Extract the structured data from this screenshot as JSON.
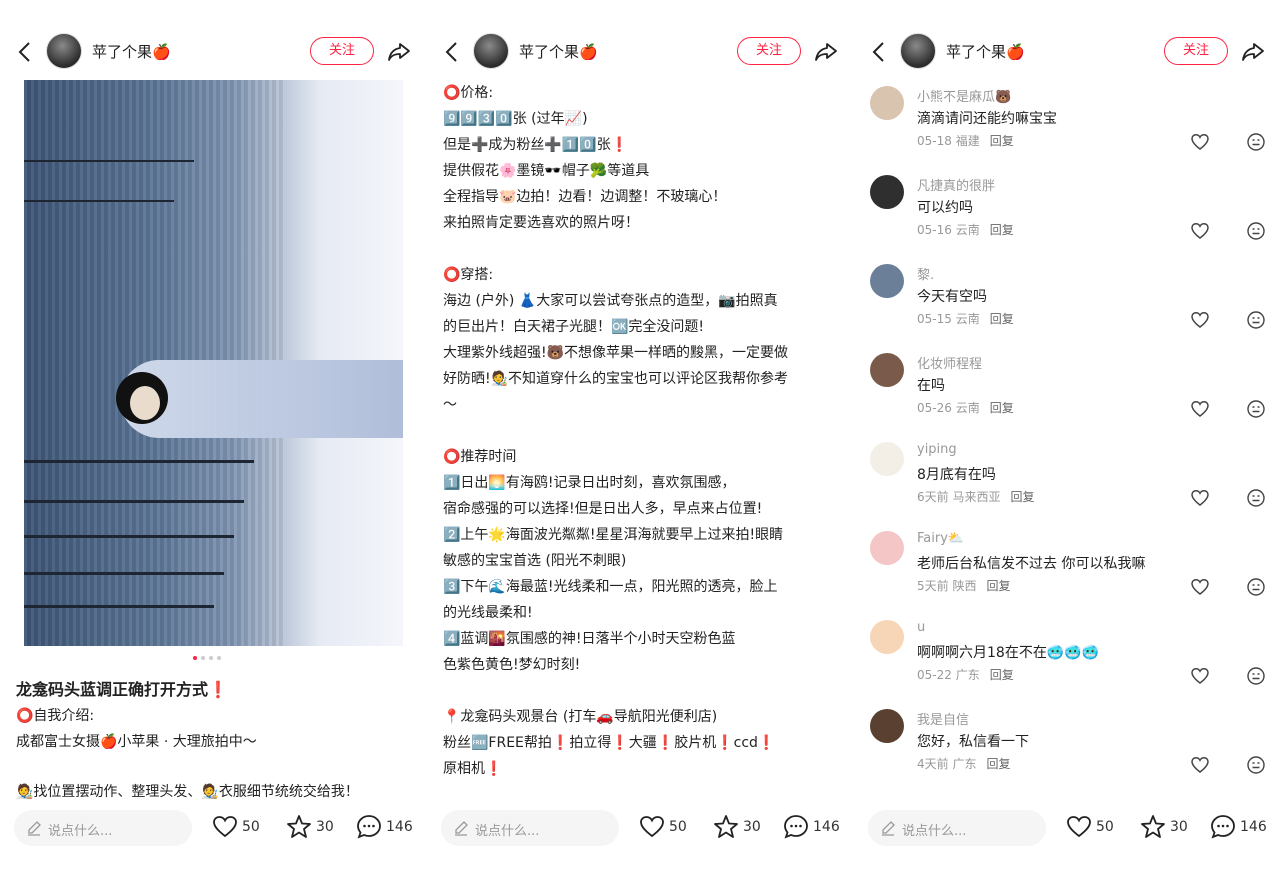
{
  "header": {
    "username": "苹了个果🍎",
    "follow_label": "关注"
  },
  "post": {
    "title": "龙龛码头蓝调正确打开方式❗",
    "intro_label": "⭕自我介绍:",
    "intro_text": "成都富士女摄🍎小苹果 · 大理旅拍中～",
    "more_text": "🧑‍🎨找位置摆动作、整理头发、🧑‍🎨衣服细节统统交给我！"
  },
  "detail_lines": [
    "⭕价格:",
    "9️⃣9️⃣3️⃣0️⃣张 (过年📈)",
    "但是➕成为粉丝➕1️⃣0️⃣张❗",
    "提供假花🌸墨镜🕶️帽子🥦等道具",
    "全程指导🐷边拍！边看！边调整！不玻璃心！",
    "来拍照肯定要选喜欢的照片呀！",
    "",
    "⭕穿搭:",
    "海边 (户外) 👗大家可以尝试夸张点的造型，📷拍照真",
    "的巨出片！白天裙子光腿！🆗完全没问题!",
    "大理紫外线超强!🐻不想像苹果一样晒的黢黑，一定要做",
    "好防晒!🧑‍🎨不知道穿什么的宝宝也可以评论区我帮你参考",
    "～",
    "",
    "⭕推荐时间",
    "1️⃣日出🌅有海鸥!记录日出时刻，喜欢氛围感，",
    "宿命感强的可以选择!但是日出人多，早点来占位置!",
    "2️⃣上午🌟海面波光粼粼!星星洱海就要早上过来拍!眼睛",
    "敏感的宝宝首选 (阳光不刺眼)",
    "3️⃣下午🌊海最蓝!光线柔和一点，阳光照的透亮，脸上",
    "的光线最柔和!",
    "4️⃣蓝调🌇氛围感的神!日落半个小时天空粉色蓝",
    "色紫色黄色!梦幻时刻!",
    "",
    "📍龙龛码头观景台 (打车🚗导航阳光便利店)",
    "粉丝🆓FREE帮拍❗拍立得❗大疆❗胶片机❗ccd❗",
    "原相机❗"
  ],
  "comments": [
    {
      "name": "小熊不是麻瓜🐻",
      "text": "滴滴请问还能约嘛宝宝",
      "date": "05-18",
      "location": "福建",
      "avatar_color": "#d9c4b0"
    },
    {
      "name": "凡捷真的很胖",
      "text": "可以约吗",
      "date": "05-16",
      "location": "云南",
      "avatar_color": "#2f2f2f"
    },
    {
      "name": "黎.",
      "text": "今天有空吗",
      "date": "05-15",
      "location": "云南",
      "avatar_color": "#6b7f99"
    },
    {
      "name": "化妆师程程",
      "text": "在吗",
      "date": "05-26",
      "location": "云南",
      "avatar_color": "#7a5a4a"
    },
    {
      "name": "yiping",
      "text": "8月底有在吗",
      "date": "6天前",
      "location": "马来西亚",
      "avatar_color": "#f3efe6"
    },
    {
      "name": "Fairy⛅",
      "text": "老师后台私信发不过去 你可以私我嘛",
      "date": "5天前",
      "location": "陕西",
      "avatar_color": "#f4c6c6"
    },
    {
      "name": "u",
      "text": "啊啊啊六月18在不在🥶🥶🥶",
      "date": "05-22",
      "location": "广东",
      "avatar_color": "#f7d6b8"
    },
    {
      "name": "我是自信",
      "text": "您好，私信看一下",
      "date": "4天前",
      "location": "广东",
      "avatar_color": "#5a4030"
    }
  ],
  "reply_label": "回复",
  "bottom": {
    "placeholder": "说点什么...",
    "likes": "50",
    "stars": "30",
    "comments": "146"
  },
  "colors": {
    "accent": "#ff2442"
  }
}
